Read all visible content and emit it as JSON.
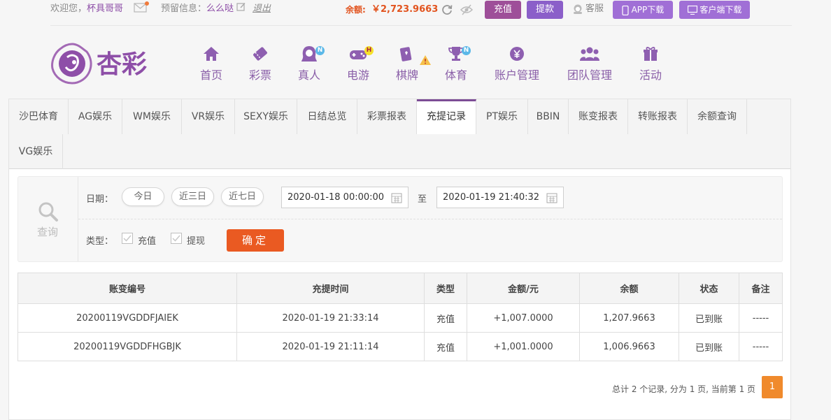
{
  "topbar": {
    "welcome": "欢迎您，",
    "username": "杯具哥哥",
    "reserved_label": "预留信息：",
    "reserved_value": "么么哒",
    "logout": "退出",
    "balance_label": "余额:",
    "balance_value": "￥2,723.9663",
    "recharge": "充值",
    "withdraw": "提款",
    "service": "客服",
    "app_download": "APP下载",
    "client_download": "客户端下载"
  },
  "logo_text": "杏彩",
  "nav": [
    {
      "label": "首页",
      "icon": "home-icon"
    },
    {
      "label": "彩票",
      "icon": "ticket-icon"
    },
    {
      "label": "真人",
      "icon": "dealer-icon",
      "badge": "N"
    },
    {
      "label": "电游",
      "icon": "gamepad-icon",
      "badge": "H"
    },
    {
      "label": "棋牌",
      "icon": "cards-icon"
    },
    {
      "label": "体育",
      "icon": "trophy-icon",
      "badge": "N"
    },
    {
      "label": "账户管理",
      "icon": "yen-coin-icon"
    },
    {
      "label": "团队管理",
      "icon": "team-icon"
    },
    {
      "label": "活动",
      "icon": "gift-icon"
    }
  ],
  "tabs": [
    "沙巴体育",
    "AG娱乐",
    "WM娱乐",
    "VR娱乐",
    "SEXY娱乐",
    "日结总览",
    "彩票报表",
    "充提记录",
    "PT娱乐",
    "BBIN",
    "账变报表",
    "转账报表",
    "余额查询",
    "VG娱乐"
  ],
  "search": {
    "side_label": "查询",
    "date_label": "日期：",
    "quick": [
      "今日",
      "近三日",
      "近七日"
    ],
    "start": "2020-01-18 00:00:00",
    "to": "至",
    "end": "2020-01-19 21:40:32",
    "type_label": "类型：",
    "type_recharge": "充值",
    "type_withdraw": "提现",
    "confirm": "确定"
  },
  "table": {
    "headers": [
      "账变编号",
      "充提时间",
      "类型",
      "金额/元",
      "余额",
      "状态",
      "备注"
    ],
    "rows": [
      [
        "20200119VGDDFJAIEK",
        "2020-01-19 21:33:14",
        "充值",
        "+1,007.0000",
        "1,207.9663",
        "已到账",
        "-----"
      ],
      [
        "20200119VGDDFHGBJK",
        "2020-01-19 21:11:14",
        "充值",
        "+1,001.0000",
        "1,006.9663",
        "已到账",
        "-----"
      ]
    ]
  },
  "pager": {
    "summary": "总计 2 个记录, 分为 1 页, 当前第 1 页",
    "current": "1"
  },
  "colors": {
    "brand": "#8e4fa8",
    "balance": "#e2541f",
    "confirm": "#ea5a22",
    "amount": "#c81818",
    "status_ok": "#2ca02c",
    "page_active": "#f08a2c"
  }
}
